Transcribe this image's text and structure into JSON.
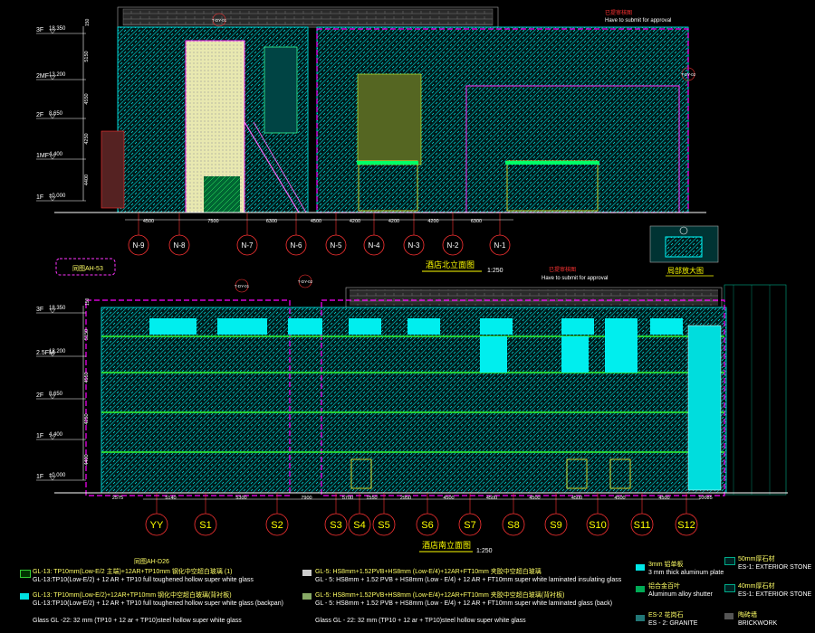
{
  "north": {
    "levels": [
      {
        "label": "3F",
        "elev": "18.350"
      },
      {
        "label": "2MF",
        "elev": "13.200"
      },
      {
        "label": "2F",
        "elev": "8.650"
      },
      {
        "label": "1MF",
        "elev": "4.400"
      },
      {
        "label": "1F",
        "elev": "±0.000"
      }
    ],
    "level_dims": [
      "5150",
      "4550",
      "4250",
      "4400"
    ],
    "top_dim": "150",
    "axes": [
      "N-9",
      "N-8",
      "N-7",
      "N-6",
      "N-5",
      "N-4",
      "N-3",
      "N-2",
      "N-1"
    ],
    "spacings": [
      "4500",
      "7500",
      "6300",
      "4500",
      "4200",
      "4200",
      "4200",
      "6300"
    ],
    "title": "酒店北立面图",
    "scale": "1:250",
    "submit_note_zh": "已提审核图",
    "submit_note_en": "Have to submit for approval",
    "tags": [
      "T-DY-01",
      "T-DY-02"
    ]
  },
  "detail": {
    "title": "局部放大图"
  },
  "south": {
    "levels": [
      {
        "label": "3F",
        "elev": "18.350"
      },
      {
        "label": "2.5FM",
        "elev": "13.200"
      },
      {
        "label": "2F",
        "elev": "8.650"
      },
      {
        "label": "1F",
        "elev": "4.400"
      },
      {
        "label": "1F",
        "elev": "±0.000"
      }
    ],
    "level_dims": [
      "5150",
      "4550",
      "4250",
      "4400"
    ],
    "top_dim": "150",
    "axes": [
      "YY",
      "S1",
      "S2",
      "S3",
      "S4",
      "S5",
      "S6",
      "S7",
      "S8",
      "S9",
      "S10",
      "S11",
      "S12"
    ],
    "spacings": [
      "2575",
      "5140",
      "5300",
      "7900",
      "5700",
      "1550",
      "2950",
      "4500",
      "4500",
      "4500",
      "4500",
      "4500",
      "4500",
      "10085"
    ],
    "callout": "同图AH-53",
    "tags": [
      "T-DY-01",
      "T-DY-02"
    ],
    "submit_note_zh": "已提审核图",
    "submit_note_en": "Have to submit for approval",
    "title": "酒店南立面图",
    "scale": "1:250"
  },
  "legend_ref": "同图AH-D26",
  "legend": [
    {
      "zh": "GL-13: TP10mm(Low-E/2 主端)+12AR+TP10mm 钢化中空超白玻璃 (1)",
      "en": "GL-13:TP10(Low-E/2) + 12 AR + TP10 full toughened hollow super white glass",
      "color": "#33cc33"
    },
    {
      "zh": "GL-13: TP10mm(Low-E/2)+12AR+TP10mm 钢化中空超白玻璃(背衬板)",
      "en": "GL-13:TP10(Low-E/2) + 12 AR + TP10 full toughened hollow super white glass (backpan)",
      "color": "#00e0e0"
    },
    {
      "zh": "Glass GL-22: 32mm (TP10+12ar+TP10)中空钢化超白玻璃",
      "en": "Glass GL -22: 32 mm (TP10 + 12 ar + TP10)steel hollow super white glass",
      "color": ""
    },
    {
      "zh": "GL-5: HS8mm+1.52PVB+HS8mm (Low-E/4)+12AR+FT10mm 夹胶中空超白玻璃",
      "en": "GL - 5: HS8mm + 1.52 PVB + HS8mm (Low - E/4) + 12 AR + FT10mm super white laminated insulating glass",
      "color": "#cccccc"
    },
    {
      "zh": "GL-5: HS8mm+1.52PVB+HS8mm (Low-E/4)+12AR+FT10mm 夹胶中空超白玻璃(背衬板)",
      "en": "GL - 5: HS8mm + 1.52 PVB + HS8mm (Low - E/4) + 12 AR + FT10mm super white laminated glass (back)",
      "color": "#88aa66"
    },
    {
      "zh": "Glass GL-22: 32mm (TP10+12ar+TP10)中空钢化超白玻璃",
      "en": "Glass GL - 22: 32 mm (TP10 + 12 ar + TP10)steel hollow super white glass",
      "color": ""
    }
  ],
  "legend_right": [
    {
      "zh": "3mm 铝单板",
      "en": "3 mm thick aluminum plate",
      "color": "#00e8e8"
    },
    {
      "zh": "铝合金百叶",
      "en": "Aluminum alloy shutter",
      "color": "#00aa55"
    },
    {
      "zh": "ES-2 花岗石",
      "en": "ES - 2: GRANITE",
      "color": "#227777"
    }
  ],
  "legend_far": [
    {
      "zh": "50mm厚石材",
      "en": "ES-1: EXTERIOR STONE"
    },
    {
      "zh": "40mm厚石材",
      "en": "ES-1: EXTERIOR STONE"
    },
    {
      "zh": "陶砖墙",
      "en": "BRICKWORK"
    }
  ]
}
